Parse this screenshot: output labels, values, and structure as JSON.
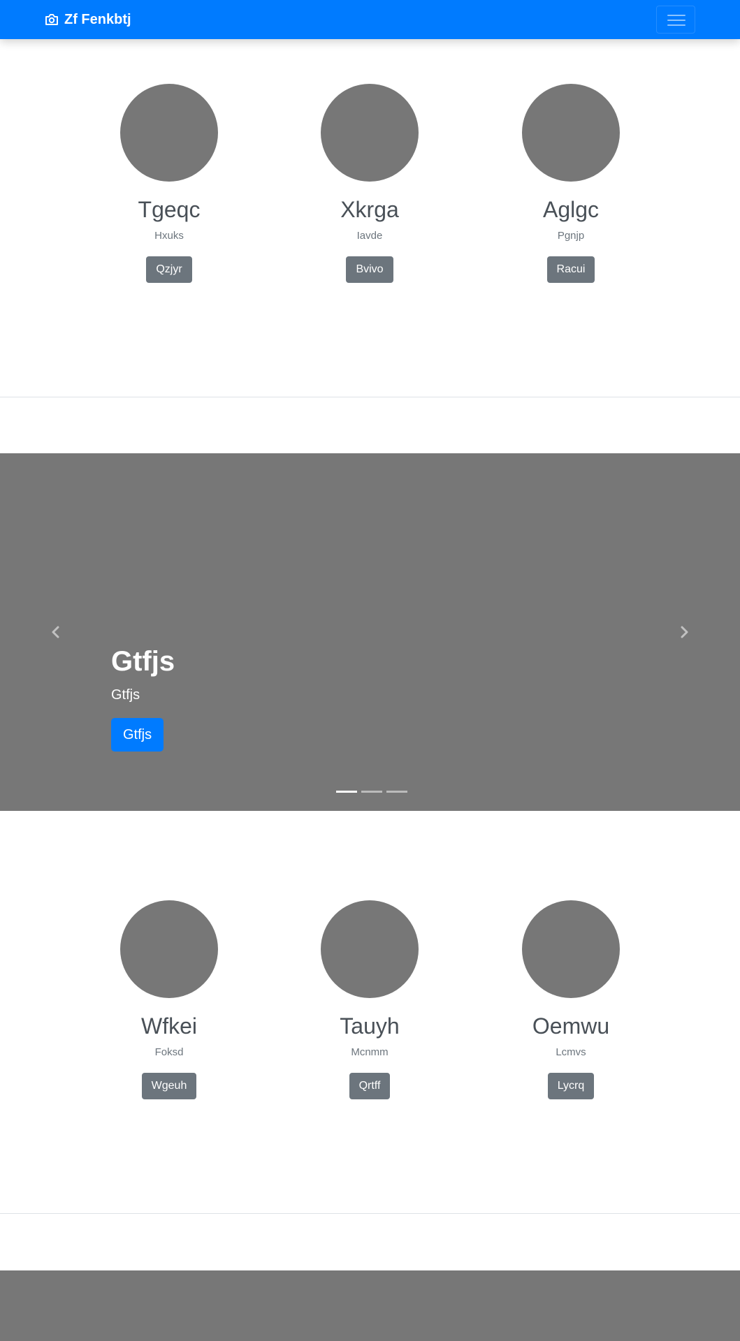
{
  "navbar": {
    "brand": "Zf Fenkbtj",
    "brand_icon": "camera-icon",
    "toggler_icon": "hamburger-icon"
  },
  "team_top": [
    {
      "name": "Tgeqc",
      "role": "Hxuks",
      "button": "Qzjyr"
    },
    {
      "name": "Xkrga",
      "role": "Iavde",
      "button": "Bvivo"
    },
    {
      "name": "Aglgc",
      "role": "Pgnjp",
      "button": "Racui"
    }
  ],
  "carousel": {
    "title": "Gtfjs",
    "text": "Gtfjs",
    "button": "Gtfjs",
    "indicators": 3,
    "active_index": 0,
    "prev_icon": "chevron-left-icon",
    "next_icon": "chevron-right-icon"
  },
  "team_bottom": [
    {
      "name": "Wfkei",
      "role": "Foksd",
      "button": "Wgeuh"
    },
    {
      "name": "Tauyh",
      "role": "Mcnmm",
      "button": "Qrtff"
    },
    {
      "name": "Oemwu",
      "role": "Lcmvs",
      "button": "Lycrq"
    }
  ],
  "colors": {
    "primary": "#007bff",
    "secondary": "#6c757d",
    "placeholder": "#777777"
  }
}
